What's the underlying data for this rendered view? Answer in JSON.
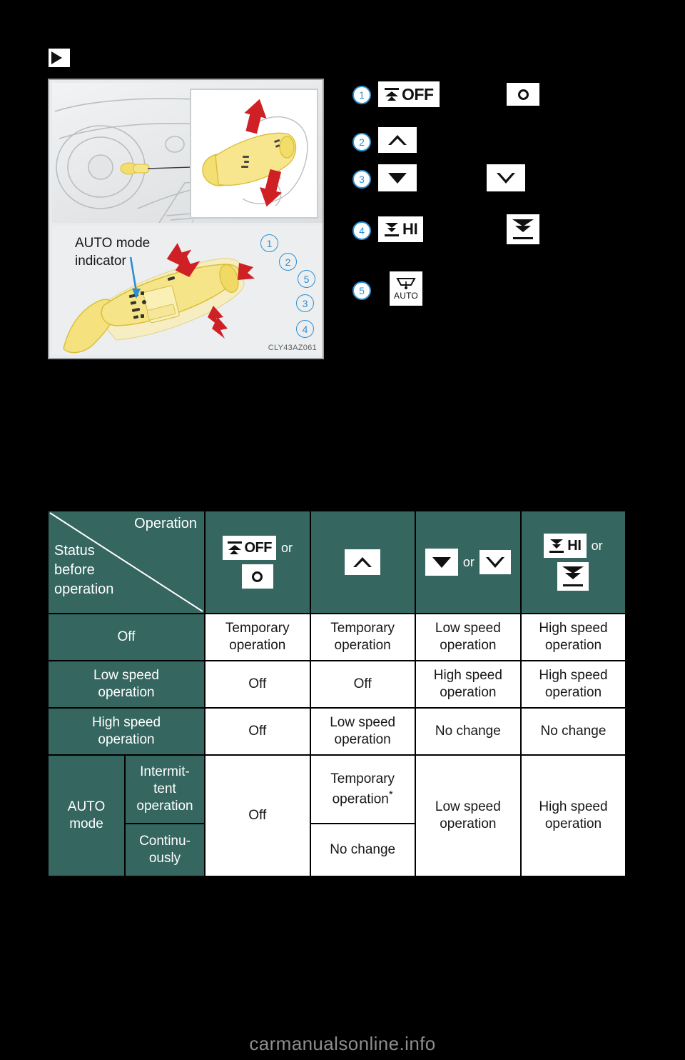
{
  "section": {
    "marker_icon": "black-right-triangle"
  },
  "illustration": {
    "auto_mode_label_line1": "AUTO mode",
    "auto_mode_label_line2": "indicator",
    "code": "CLY43AZ061",
    "callouts": [
      "1",
      "2",
      "5",
      "3",
      "4"
    ]
  },
  "legend": {
    "items": [
      {
        "num": "1",
        "icon": "wiper-mist-off-icon",
        "text": "OFF",
        "alt_icon": "ring-icon",
        "alt_text": ""
      },
      {
        "num": "2",
        "icon": "triangle-up-outline-icon",
        "text": "",
        "alt_icon": "",
        "alt_text": ""
      },
      {
        "num": "3",
        "icon": "triangle-down-solid-icon",
        "text": "",
        "alt_icon": "triangle-down-outline-icon",
        "alt_text": ""
      },
      {
        "num": "4",
        "icon": "wiper-hi-icon",
        "text": "HI",
        "alt_icon": "double-wipe-icon",
        "alt_text": ""
      },
      {
        "num": "5",
        "icon": "wiper-auto-icon",
        "text": "AUTO",
        "alt_icon": "",
        "alt_text": ""
      }
    ]
  },
  "table": {
    "corner": {
      "operation_label": "Operation",
      "status_label_lines": [
        "Status",
        "before",
        "operation"
      ]
    },
    "or_label": "or",
    "columns": [
      {
        "id": "col-off",
        "icons": [
          "wiper-mist-off-icon",
          "ring-icon"
        ],
        "text": "OFF",
        "has_or": true
      },
      {
        "id": "col-up",
        "icons": [
          "triangle-up-outline-icon"
        ],
        "text": "",
        "has_or": false
      },
      {
        "id": "col-down",
        "icons": [
          "triangle-down-solid-icon",
          "triangle-down-outline-icon"
        ],
        "text": "",
        "has_or": true
      },
      {
        "id": "col-hi",
        "icons": [
          "wiper-hi-icon",
          "double-wipe-icon"
        ],
        "text": "HI",
        "has_or": true
      }
    ],
    "rows": [
      {
        "status": "Off",
        "status_sub": "",
        "cells": [
          "Temporary operation",
          "Temporary operation",
          "Low speed operation",
          "High speed operation"
        ]
      },
      {
        "status": "Low speed operation",
        "status_sub": "",
        "cells": [
          "Off",
          "Off",
          "High speed operation",
          "High speed operation"
        ]
      },
      {
        "status": "High speed operation",
        "status_sub": "",
        "cells": [
          "Off",
          "Low speed operation",
          "No change",
          "No change"
        ]
      },
      {
        "status": "AUTO mode",
        "status_sub": "Intermit- tent operation",
        "cells": [
          "Off",
          "Temporary operation",
          "Low speed operation",
          "High speed operation"
        ],
        "cell_star": true
      },
      {
        "status": "",
        "status_sub": "Continu- ously",
        "cells": [
          "",
          "No change",
          "",
          ""
        ]
      }
    ],
    "labels": {
      "off": "Off",
      "temporary_operation": "Temporary operation",
      "low_speed_operation": "Low speed operation",
      "high_speed_operation": "High speed operation",
      "no_change": "No change",
      "auto_mode_l1": "AUTO",
      "auto_mode_l2": "mode",
      "intermittent_l1": "Intermit-",
      "intermittent_l2": "tent",
      "intermittent_l3": "operation",
      "continuously_l1": "Continu-",
      "continuously_l2": "ously",
      "temporary_l1": "Temporary",
      "temporary_l2": "operation",
      "low_l1": "Low speed",
      "low_l2": "operation",
      "high_l1": "High speed",
      "high_l2": "operation",
      "star": "*"
    },
    "colors": {
      "header_bg": "#356660",
      "cell_bg": "#ffffff",
      "text_dark": "#15171a",
      "text_light": "#ffffff"
    }
  },
  "footer": {
    "watermark": "carmanualsonline.info"
  }
}
